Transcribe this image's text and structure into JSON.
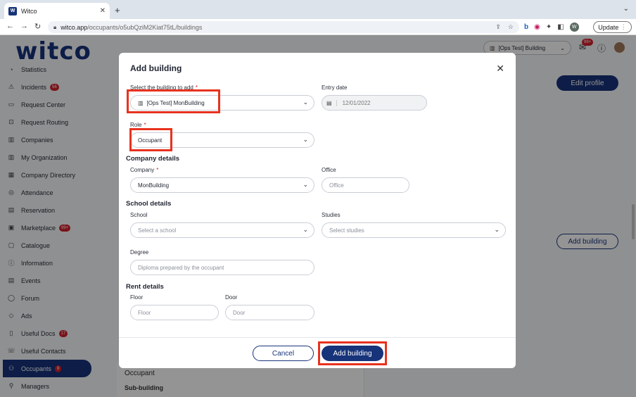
{
  "browser": {
    "tab_title": "Witco",
    "favicon_text": "W",
    "url_domain": "witco.app",
    "url_path": "/occupants/o5ubQziM2Kiat75tL/buildings",
    "update_label": "Update",
    "profile_initial": "W"
  },
  "app": {
    "logo": "witco",
    "building_selector": "[Ops Test] Building",
    "notifications_count": "99+"
  },
  "sidebar": {
    "items": [
      {
        "label": "Statistics",
        "icon": "chart-icon",
        "glyph": "◔"
      },
      {
        "label": "Incidents",
        "icon": "warning-icon",
        "glyph": "⚠",
        "count": "56"
      },
      {
        "label": "Request Center",
        "icon": "inbox-icon",
        "glyph": "▭"
      },
      {
        "label": "Request Routing",
        "icon": "routing-icon",
        "glyph": "⊡"
      },
      {
        "label": "Companies",
        "icon": "building-icon",
        "glyph": "▥"
      },
      {
        "label": "My Organization",
        "icon": "org-icon",
        "glyph": "▥"
      },
      {
        "label": "Company Directory",
        "icon": "directory-icon",
        "glyph": "▦"
      },
      {
        "label": "Attendance",
        "icon": "check-circle-icon",
        "glyph": "◎"
      },
      {
        "label": "Reservation",
        "icon": "calendar-icon",
        "glyph": "▤"
      },
      {
        "label": "Marketplace",
        "icon": "store-icon",
        "glyph": "▣",
        "count": "99+"
      },
      {
        "label": "Catalogue",
        "icon": "catalogue-icon",
        "glyph": "▢"
      },
      {
        "label": "Information",
        "icon": "info-icon",
        "glyph": "ⓘ"
      },
      {
        "label": "Events",
        "icon": "calendar-icon",
        "glyph": "▤"
      },
      {
        "label": "Forum",
        "icon": "chat-icon",
        "glyph": "◯"
      },
      {
        "label": "Ads",
        "icon": "tag-icon",
        "glyph": "◇"
      },
      {
        "label": "Useful Docs",
        "icon": "document-icon",
        "glyph": "▯",
        "count": "17"
      },
      {
        "label": "Useful Contacts",
        "icon": "phone-icon",
        "glyph": "☏"
      },
      {
        "label": "Occupants",
        "icon": "people-icon",
        "glyph": "⚇",
        "count": "8",
        "active": true
      },
      {
        "label": "Managers",
        "icon": "person-icon",
        "glyph": "⚲"
      }
    ]
  },
  "background": {
    "edit_profile": "Edit profile",
    "add_building": "Add building",
    "occupant_label": "Occupant",
    "sub_building_label": "Sub-building"
  },
  "modal": {
    "title": "Add building",
    "building_label": "Select the building to add",
    "building_value": "[Ops Test] MonBuilding",
    "entry_date_label": "Entry date",
    "entry_date_value": "12/01/2022",
    "role_label": "Role",
    "role_value": "Occupant",
    "company_details": "Company details",
    "company_label": "Company",
    "company_value": "MonBuilding",
    "office_label": "Office",
    "office_placeholder": "Office",
    "school_details": "School details",
    "school_label": "School",
    "school_placeholder": "Select a school",
    "studies_label": "Studies",
    "studies_placeholder": "Select studies",
    "degree_label": "Degree",
    "degree_placeholder": "Diploma prepared by the occupant",
    "rent_details": "Rent details",
    "floor_label": "Floor",
    "floor_placeholder": "Floor",
    "door_label": "Door",
    "door_placeholder": "Door",
    "cancel": "Cancel",
    "submit": "Add building",
    "required_mark": "*"
  },
  "colors": {
    "brand": "#17337a",
    "badge": "#d3212d",
    "highlight": "#e8321f"
  }
}
